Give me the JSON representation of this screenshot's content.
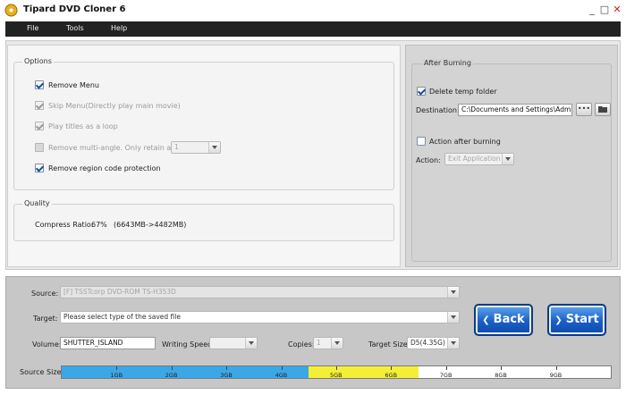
{
  "window": {
    "title": "Tipard DVD Cloner 6",
    "minimize": "_",
    "restore": "□",
    "close": "✕"
  },
  "menu": [
    "File",
    "Tools",
    "Help"
  ],
  "options": {
    "legend": "Options",
    "remove_menu": "Remove Menu",
    "skip_menu": "Skip Menu(Directly play main movie)",
    "loop": "Play titles as a loop",
    "multi_angle": "Remove multi-angle. Only retain angle",
    "angle_value": "1",
    "region": "Remove region code protection"
  },
  "quality": {
    "legend": "Quality",
    "label": "Compress Ratio:",
    "value": "67%",
    "detail": "(6643MB->4482MB)"
  },
  "after_burning": {
    "legend": "After Burning",
    "delete_temp": "Delete temp folder",
    "destination_label": "Destination:",
    "destination_value": "C:\\Documents and Settings\\Admini",
    "browse_dots": "•••",
    "action_after": "Action after burning",
    "action_label": "Action:",
    "action_value": "Exit Application"
  },
  "bottom": {
    "source_label": "Source:",
    "source_value": "[F] TSSTcorp DVD-ROM TS-H353D",
    "target_label": "Target:",
    "target_value": "Please select type of the saved file",
    "volume_label": "Volume:",
    "volume_value": "SHUTTER_ISLAND",
    "speed_label": "Writing Speed:",
    "speed_value": "",
    "copies_label": "Copies:",
    "copies_value": "1",
    "target_size_label": "Target Size:",
    "target_size_value": "D5(4.35G)",
    "source_size_label": "Source Size:",
    "back": "Back",
    "start": "Start"
  },
  "source_size_bar": {
    "ticks": [
      "1GB",
      "2GB",
      "3GB",
      "4GB",
      "5GB",
      "6GB",
      "7GB",
      "8GB",
      "9GB"
    ],
    "used_gb": 4.5,
    "compressed_range_gb": [
      4.5,
      6.5
    ],
    "max_gb": 10,
    "colors": {
      "used": "#3aa7e8",
      "overflow": "#f5ee38"
    }
  }
}
